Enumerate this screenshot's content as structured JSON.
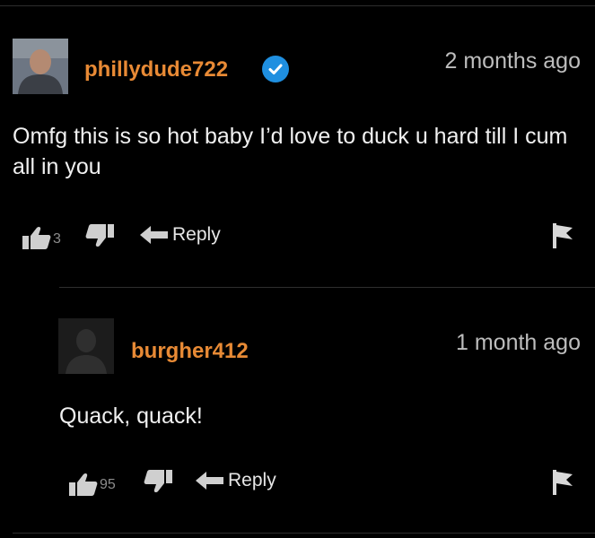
{
  "comments": [
    {
      "username": "phillydude722",
      "verified": true,
      "timestamp": "2 months ago",
      "text": "Omfg this is so hot baby I’d love to duck u hard till I cum all in you",
      "likes": "3",
      "reply_label": "Reply"
    },
    {
      "username": "burgher412",
      "verified": false,
      "timestamp": "1 month ago",
      "text": "Quack, quack!",
      "likes": "95",
      "reply_label": "Reply"
    }
  ],
  "colors": {
    "background": "#000000",
    "username": "#e88a35",
    "verified_badge": "#1f8fe0",
    "icon": "#cfcfcf"
  },
  "icons": [
    "verified-icon",
    "thumbs-up-icon",
    "thumbs-down-icon",
    "reply-arrow-icon",
    "flag-icon"
  ]
}
